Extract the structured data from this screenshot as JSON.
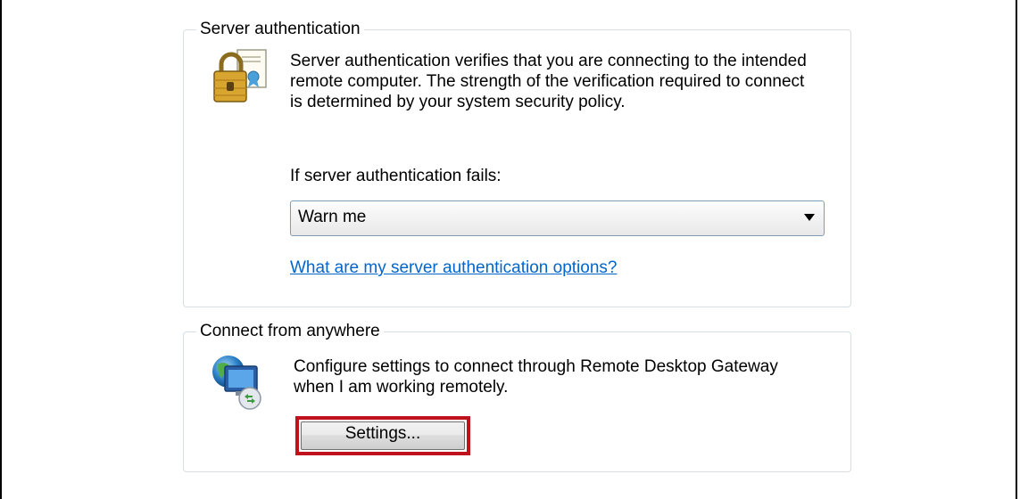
{
  "server_auth": {
    "title": "Server authentication",
    "description": "Server authentication verifies that you are connecting to the intended remote computer. The strength of the verification required to connect is determined by your system security policy.",
    "fail_label": "If server authentication fails:",
    "fail_selected": "Warn me",
    "options_link": "What are my server authentication options?",
    "icon": "padlock-certificate-icon"
  },
  "connect_anywhere": {
    "title": "Connect from anywhere",
    "description": "Configure settings to connect through Remote Desktop Gateway when I am working remotely.",
    "settings_label": "Settings...",
    "icon": "remote-desktop-gateway-icon",
    "highlight_color": "#c0121c"
  }
}
